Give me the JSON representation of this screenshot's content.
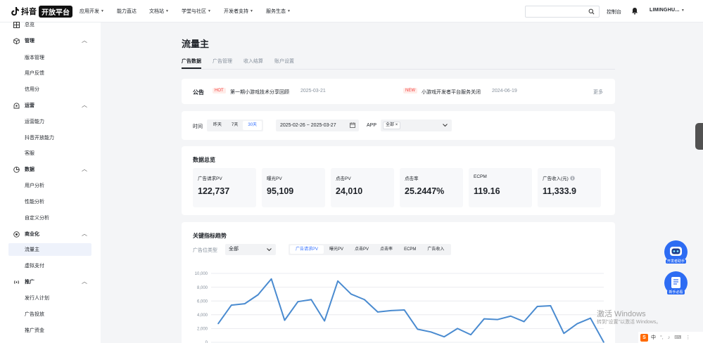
{
  "topnav": {
    "logo_text": "抖音",
    "logo_badge": "开放平台",
    "menus": [
      "应用开发",
      "能力直达",
      "文档站",
      "学堂与社区",
      "开发者支持",
      "服务生态"
    ],
    "search_placeholder": "",
    "console": "控制台",
    "user": "LIMINGHU..."
  },
  "sidebar": {
    "top_cut": "总览",
    "groups": [
      {
        "label": "管理",
        "items": [
          "版本管理",
          "用户反馈",
          "信用分"
        ]
      },
      {
        "label": "运营",
        "items": [
          "运营能力",
          "抖音开放能力",
          "客服"
        ]
      },
      {
        "label": "数据",
        "items": [
          "用户分析",
          "性能分析",
          "自定义分析"
        ]
      },
      {
        "label": "商业化",
        "items": [
          "流量主",
          "虚拟支付"
        ]
      },
      {
        "label": "推广",
        "items": [
          "发行人计划",
          "广告投放",
          "推广资金"
        ]
      }
    ]
  },
  "page": {
    "title": "流量主",
    "tabs": [
      "广告数据",
      "广告管理",
      "收入结算",
      "账户设置"
    ]
  },
  "notice": {
    "label": "公告",
    "items": [
      {
        "tag": "HOT",
        "text": "第一期小游戏技术分享回顾",
        "date": "2025-03-21"
      },
      {
        "tag": "NEW",
        "text": "小游戏开发者平台服务关闭",
        "date": "2024-06-19"
      }
    ],
    "more": "更多"
  },
  "filters": {
    "time_label": "时间",
    "ranges": [
      "昨天",
      "7天",
      "30天"
    ],
    "date_range": "2025-02-26 ~ 2025-03-27",
    "app_label": "APP",
    "app_chip": "全部"
  },
  "overview": {
    "title": "数据总览",
    "metrics": [
      {
        "label": "广告请求PV",
        "value": "122,737"
      },
      {
        "label": "曝光PV",
        "value": "95,109"
      },
      {
        "label": "点击PV",
        "value": "24,010"
      },
      {
        "label": "点击率",
        "value": "25.2447%"
      },
      {
        "label": "ECPM",
        "value": "119.16"
      },
      {
        "label": "广告收入(元)",
        "value": "11,333.9"
      }
    ]
  },
  "trend": {
    "title": "关键指标趋势",
    "type_label": "广告位类型",
    "type_value": "全部",
    "metric_tabs": [
      "广告请求PV",
      "曝光PV",
      "点击PV",
      "点击率",
      "ECPM",
      "广告收入"
    ]
  },
  "chart_data": {
    "type": "line",
    "title": "",
    "xlabel": "",
    "ylabel": "",
    "ylim": [
      0,
      10000
    ],
    "yticks": [
      "10,000",
      "8,000",
      "6,000",
      "4,000",
      "2,000",
      "0"
    ],
    "grid": true,
    "series": [
      {
        "color": "#4a8bd0",
        "values": [
          2700,
          5400,
          5600,
          6900,
          9200,
          3200,
          5900,
          6200,
          3100,
          8900,
          7000,
          6200,
          4400,
          4600,
          4700,
          1900,
          1500,
          800,
          2000,
          1100,
          3400,
          3300,
          3800,
          3000,
          5200,
          5300,
          1300,
          2700,
          3500,
          0
        ]
      }
    ]
  },
  "floating": {
    "assistant": "开发者助手",
    "guide": "新手必看",
    "watermark_title": "激活 Windows",
    "watermark_sub": "转到\"设置\"以激活 Windows。",
    "ime": "中"
  }
}
